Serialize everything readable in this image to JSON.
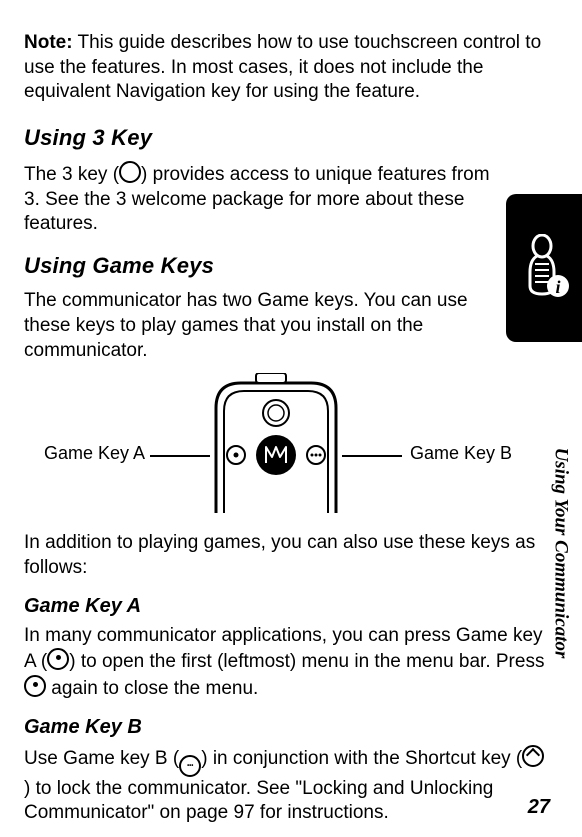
{
  "note_label": "Note:",
  "note_text": " This guide describes how to use touchscreen control to use the features. In most cases, it does not include the equivalent Navigation key for using the feature.",
  "s1_heading": "Using 3 Key",
  "s1_p1_a": "The 3 key (",
  "s1_p1_b": ") provides access to unique features from 3. See the 3 welcome package for more about these features.",
  "s2_heading": "Using Game Keys",
  "s2_p1": "The communicator has two Game keys. You can use these keys to play games that you install on the communicator.",
  "diagram_label_a": "Game Key A",
  "diagram_label_b": "Game Key B",
  "s2_p2": "In addition to playing games, you can also use these keys as follows:",
  "s2_sub_a": "Game Key A",
  "s2_a_p1_a": "In many communicator applications, you can press Game key A (",
  "s2_a_p1_b": ") to open the first (leftmost) menu in the menu bar. Press ",
  "s2_a_p1_c": " again to close the menu.",
  "s2_sub_b": "Game Key B",
  "s2_b_p1_a": "Use Game key B (",
  "s2_b_p1_b": ") in conjunction with the Shortcut key (",
  "s2_b_p1_c": ") to lock the communicator. See \"Locking and Unlocking Communicator\" on page 97 for instructions.",
  "side_label": "Using Your Communicator",
  "page_number": "27"
}
